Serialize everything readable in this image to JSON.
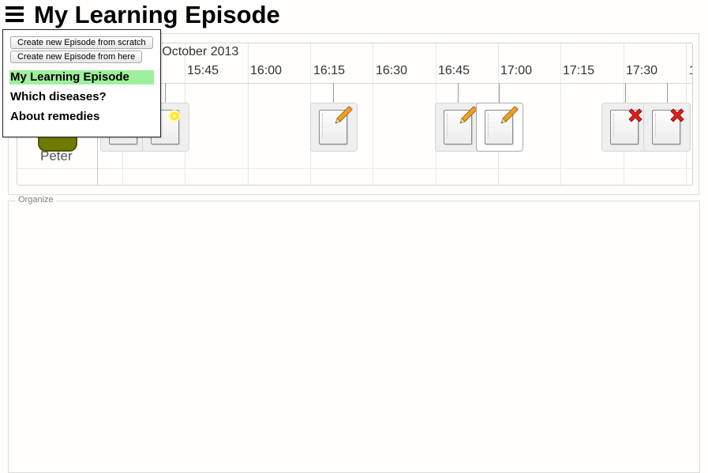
{
  "header": {
    "title": "My Learning Episode",
    "menu_icon": "hamburger-menu-icon"
  },
  "timeline": {
    "date": "5 October 2013",
    "times": [
      "15:45",
      "16:00",
      "16:15",
      "16:30",
      "16:45",
      "17:00",
      "17:15",
      "17:30",
      "1"
    ],
    "user": {
      "name": "Peter",
      "avatar_color": "#707a00"
    },
    "activities": [
      {
        "type": "document",
        "icon": "document-icon"
      },
      {
        "type": "document-new",
        "icon": "new-sparkle-icon"
      },
      {
        "type": "edit",
        "icon": "pencil-icon"
      },
      {
        "type": "edit",
        "icon": "pencil-icon"
      },
      {
        "type": "edit",
        "icon": "pencil-icon",
        "selected": true
      },
      {
        "type": "delete",
        "icon": "red-cross-icon"
      },
      {
        "type": "delete",
        "icon": "red-cross-icon"
      }
    ]
  },
  "organize": {
    "legend": "Organize"
  },
  "menu": {
    "buttons": {
      "from_scratch": "Create new Episode from scratch",
      "from_here": "Create new Episode from here"
    },
    "items": [
      {
        "label": "My Learning Episode",
        "active": true
      },
      {
        "label": "Which diseases?",
        "active": false
      },
      {
        "label": "About remedies",
        "active": false
      }
    ],
    "active_color": "#9ef09b"
  }
}
